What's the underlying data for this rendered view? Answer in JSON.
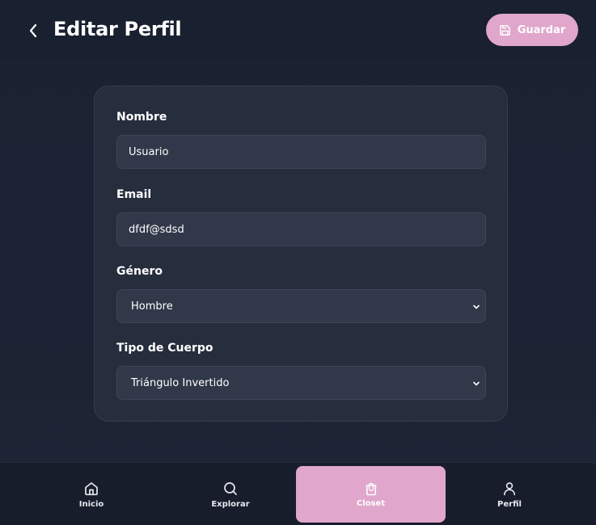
{
  "header": {
    "title": "Editar Perfil",
    "save_label": "Guardar"
  },
  "form": {
    "name": {
      "label": "Nombre",
      "value": "Usuario"
    },
    "email": {
      "label": "Email",
      "value": "dfdf@sdsd"
    },
    "gender": {
      "label": "Género",
      "selected": "Hombre"
    },
    "body_type": {
      "label": "Tipo de Cuerpo",
      "selected": "Triángulo Invertido"
    }
  },
  "bottom_nav": {
    "items": [
      {
        "label": "Inicio",
        "icon": "home-icon"
      },
      {
        "label": "Explorar",
        "icon": "search-icon"
      },
      {
        "label": "Closet",
        "icon": "shopping-bag-icon",
        "active": true
      },
      {
        "label": "Perfil",
        "icon": "user-icon"
      }
    ]
  },
  "colors": {
    "accent": "#e0a6cb",
    "background": "#1b2232",
    "card": "#262d3d",
    "input": "#313849"
  }
}
